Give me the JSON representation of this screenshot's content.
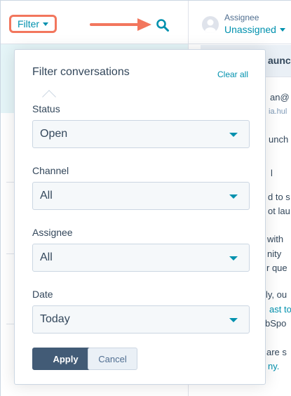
{
  "toolbar": {
    "filter_label": "Filter"
  },
  "assignee": {
    "label": "Assignee",
    "value": "Unassigned"
  },
  "conversation": {
    "subject": "aunc",
    "lines": [
      {
        "text": "an@",
        "muted": false,
        "link": false
      },
      {
        "text": "ia.hul",
        "muted": true,
        "link": false
      },
      {
        "text": "unch",
        "muted": false,
        "link": false
      },
      {
        "text": "l",
        "muted": false,
        "link": false
      },
      {
        "text": "d to s",
        "muted": false,
        "link": false
      },
      {
        "text": "ot lau",
        "muted": false,
        "link": false
      },
      {
        "text": "with",
        "muted": false,
        "link": false
      },
      {
        "text": "nity",
        "muted": false,
        "link": false
      },
      {
        "text": "r que",
        "muted": false,
        "link": false
      },
      {
        "text": "ly, ou",
        "muted": false,
        "link": false
      },
      {
        "text": "ast to",
        "muted": false,
        "link": true
      },
      {
        "text": "bSpo",
        "muted": false,
        "link": false
      },
      {
        "text": "are s",
        "muted": false,
        "link": false
      },
      {
        "text": "ny.",
        "muted": false,
        "link": true
      }
    ]
  },
  "filter_panel": {
    "title": "Filter conversations",
    "clear_all": "Clear all",
    "status": {
      "label": "Status",
      "value": "Open"
    },
    "channel": {
      "label": "Channel",
      "value": "All"
    },
    "assignee": {
      "label": "Assignee",
      "value": "All"
    },
    "date": {
      "label": "Date",
      "value": "Today"
    },
    "apply_label": "Apply",
    "cancel_label": "Cancel"
  },
  "colors": {
    "accent": "#0091ae",
    "highlight": "#f2765d",
    "primary_button": "#425b76",
    "selected_row": "#e5f5f8"
  },
  "icons": [
    "search-icon",
    "caret-down-icon",
    "avatar-icon",
    "annotation-arrow"
  ]
}
